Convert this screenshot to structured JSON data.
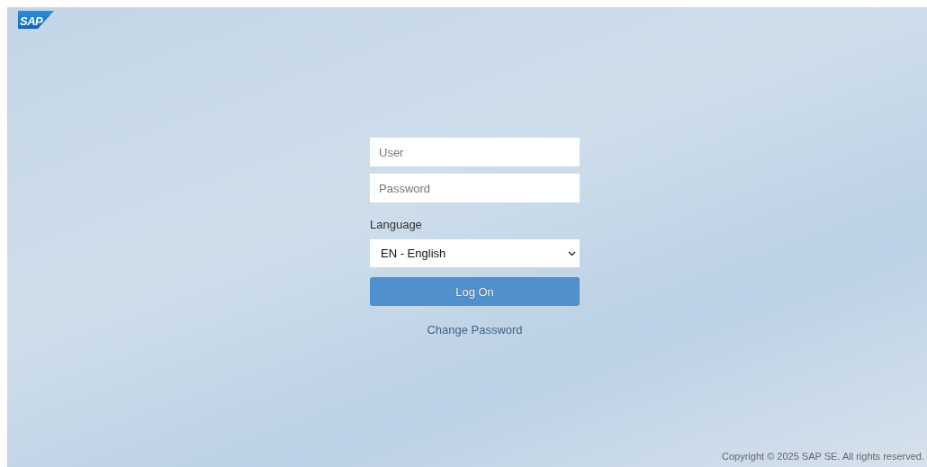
{
  "logo": {
    "text": "SAP"
  },
  "login_form": {
    "user": {
      "placeholder": "User"
    },
    "password": {
      "placeholder": "Password"
    },
    "language_label": "Language",
    "language": {
      "value": "EN - English"
    },
    "log_on_button": "Log On",
    "change_password_link": "Change Password"
  },
  "footer": {
    "copyright": "Copyright © 2025 SAP SE. All rights reserved."
  }
}
